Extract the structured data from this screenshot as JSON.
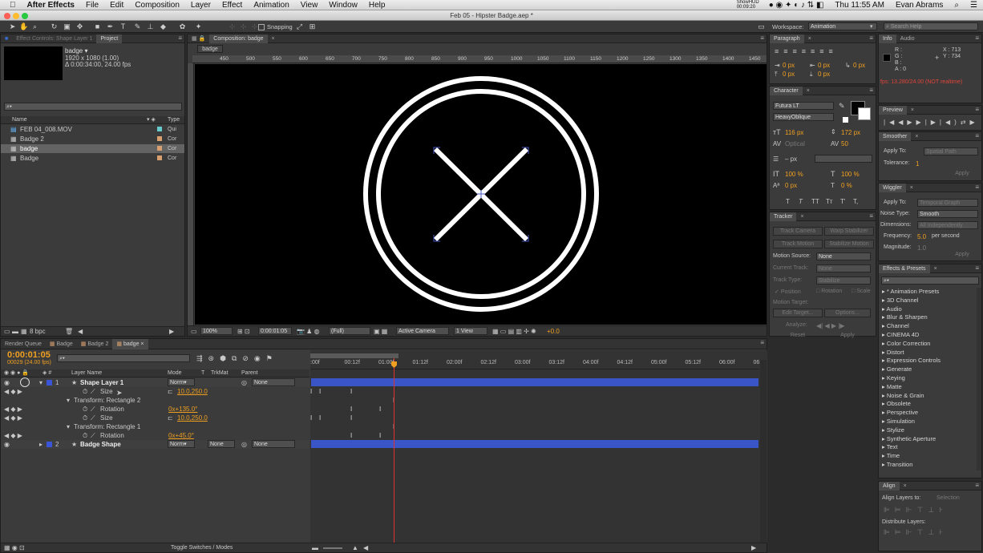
{
  "menubar": {
    "app_name": "After Effects",
    "items": [
      "File",
      "Edit",
      "Composition",
      "Layer",
      "Effect",
      "Animation",
      "View",
      "Window",
      "Help"
    ],
    "status_time_small": "ShowHUD 00:09:20",
    "clock": "Thu 11:55 AM",
    "user": "Evan Abrams"
  },
  "titlebar": {
    "title": "Feb 05 - Hipster Badge.aep *"
  },
  "toolbar": {
    "snapping_label": "Snapping",
    "workspace_label": "Workspace:",
    "workspace_value": "Animation",
    "search_placeholder": "Search Help"
  },
  "project_panel": {
    "tab_effect_controls": "Effect Controls: Shape Layer 1",
    "tab_project": "Project",
    "item_name": "badge ▾",
    "item_info1": "1920 x 1080 (1.00)",
    "item_info2": "Δ 0:00:34:00, 24.00 fps",
    "col_name": "Name",
    "col_type": "Type",
    "items": [
      {
        "name": "FEB 04_008.MOV",
        "type": "Qui"
      },
      {
        "name": "Badge 2",
        "type": "Cor"
      },
      {
        "name": "badge",
        "type": "Cor"
      },
      {
        "name": "Badge",
        "type": "Cor"
      }
    ],
    "bpc": "8 bpc"
  },
  "composition_panel": {
    "tab": "Composition: badge",
    "sub_tab": "badge",
    "ruler_labels": [
      "450",
      "500",
      "550",
      "600",
      "650",
      "700",
      "750",
      "800",
      "850",
      "900",
      "950",
      "1000",
      "1050",
      "1100",
      "1150",
      "1200",
      "1250",
      "1300",
      "1350",
      "1400",
      "1450"
    ],
    "zoom": "100%",
    "timecode": "0:00:01:05",
    "resolution": "(Full)",
    "camera": "Active Camera",
    "views": "1 View",
    "exposure": "+0.0"
  },
  "paragraph_panel": {
    "tab": "Paragraph",
    "values": [
      "0 px",
      "0 px",
      "0 px",
      "0 px",
      "0 px"
    ]
  },
  "character_panel": {
    "tab": "Character",
    "font": "Futura LT",
    "style": "HeavyOblique",
    "size": "116 px",
    "leading": "172 px",
    "kerning": "Optical",
    "tracking": "50",
    "stroke": "– px",
    "vscale": "100 %",
    "hscale": "100 %",
    "baseline": "0 px",
    "tsume": "0 %",
    "styles": [
      "T",
      "T",
      "TT",
      "Tт",
      "T'",
      "T,"
    ]
  },
  "tracker_panel": {
    "tab": "Tracker",
    "buttons": [
      "Track Camera",
      "Warp Stabilizer",
      "Track Motion",
      "Stabilize Motion"
    ],
    "motion_source_label": "Motion Source:",
    "motion_source_value": "None",
    "current_track_label": "Current Track:",
    "current_track_value": "None",
    "track_type_label": "Track Type:",
    "track_type_value": "Stabilize",
    "checks": [
      "Position",
      "Rotation",
      "Scale"
    ],
    "motion_target_label": "Motion Target:",
    "edit_target": "Edit Target...",
    "options": "Options...",
    "analyze_label": "Analyze:",
    "reset": "Reset",
    "apply": "Apply"
  },
  "info_panel": {
    "tabs": [
      "Info",
      "Audio"
    ],
    "r": "R :",
    "g": "G :",
    "b": "B :",
    "a": "A : 0",
    "x": "X : 713",
    "y": "Y : 734",
    "fps": "fps: 13.280/24.00 (NOT realtime)"
  },
  "preview_panel": {
    "tab": "Preview"
  },
  "smoother_panel": {
    "tab": "Smoother",
    "apply_to_label": "Apply To:",
    "apply_to_value": "Spatial Path",
    "tolerance_label": "Tolerance:",
    "tolerance_value": "1",
    "apply": "Apply"
  },
  "wiggler_panel": {
    "tab": "Wiggler",
    "apply_to_label": "Apply To:",
    "apply_to_value": "Temporal Graph",
    "noise_label": "Noise Type:",
    "noise_value": "Smooth",
    "dimensions_label": "Dimensions:",
    "dimensions_value": "All Independently",
    "frequency_label": "Frequency:",
    "frequency_value": "5.0",
    "frequency_unit": "per second",
    "magnitude_label": "Magnitude:",
    "magnitude_value": "1.0",
    "apply": "Apply"
  },
  "effects_panel": {
    "tab": "Effects & Presets",
    "items": [
      "* Animation Presets",
      "3D Channel",
      "Audio",
      "Blur & Sharpen",
      "Channel",
      "CINEMA 4D",
      "Color Correction",
      "Distort",
      "Expression Controls",
      "Generate",
      "Keying",
      "Matte",
      "Noise & Grain",
      "Obsolete",
      "Perspective",
      "Simulation",
      "Stylize",
      "Synthetic Aperture",
      "Text",
      "Time",
      "Transition"
    ]
  },
  "align_panel": {
    "tab": "Align",
    "align_label": "Align Layers to:",
    "align_value": "Selection",
    "distribute_label": "Distribute Layers:"
  },
  "timeline": {
    "tabs": [
      "Render Queue",
      "Badge",
      "Badge 2",
      "badge"
    ],
    "timecode": "0:00:01:05",
    "frames": "00029 (24.00 fps)",
    "col_layer_name": "Layer Name",
    "col_mode": "Mode",
    "col_t": "T",
    "col_trkmat": "TrkMat",
    "col_parent": "Parent",
    "ruler": [
      ":00f",
      "00:12f",
      "01:00f",
      "01:12f",
      "02:00f",
      "02:12f",
      "03:00f",
      "03:12f",
      "04:00f",
      "04:12f",
      "05:00f",
      "05:12f",
      "06:00f",
      "06:1"
    ],
    "rows": [
      {
        "num": "1",
        "name": "Shape Layer 1",
        "mode": "Norm▾",
        "parent": "None"
      },
      {
        "prop": "Size",
        "value": "10.0,250.0"
      },
      {
        "group": "Transform: Rectangle 2"
      },
      {
        "prop": "Rotation",
        "value": "0x+135.0°"
      },
      {
        "prop": "Size",
        "value": "10.0,250.0"
      },
      {
        "group": "Transform: Rectangle 1"
      },
      {
        "prop": "Rotation",
        "value": "0x+45.0°"
      },
      {
        "num": "2",
        "name": "Badge Shape",
        "mode": "Norm▾",
        "trkmat": "None",
        "parent": "None"
      }
    ],
    "footer": "Toggle Switches / Modes"
  }
}
